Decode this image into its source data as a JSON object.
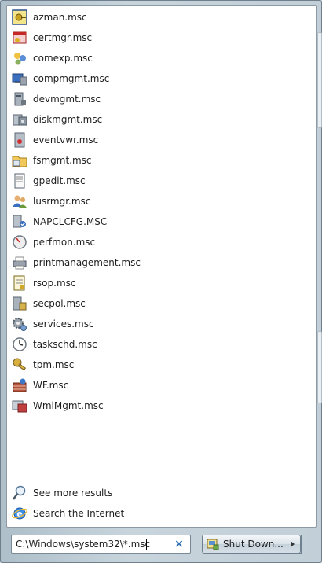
{
  "results": [
    {
      "label": "azman.msc",
      "icon": "azman-icon"
    },
    {
      "label": "certmgr.msc",
      "icon": "certmgr-icon"
    },
    {
      "label": "comexp.msc",
      "icon": "comexp-icon"
    },
    {
      "label": "compmgmt.msc",
      "icon": "compmgmt-icon"
    },
    {
      "label": "devmgmt.msc",
      "icon": "devmgmt-icon"
    },
    {
      "label": "diskmgmt.msc",
      "icon": "diskmgmt-icon"
    },
    {
      "label": "eventvwr.msc",
      "icon": "eventvwr-icon"
    },
    {
      "label": "fsmgmt.msc",
      "icon": "fsmgmt-icon"
    },
    {
      "label": "gpedit.msc",
      "icon": "gpedit-icon"
    },
    {
      "label": "lusrmgr.msc",
      "icon": "lusrmgr-icon"
    },
    {
      "label": "NAPCLCFG.MSC",
      "icon": "napclcfg-icon"
    },
    {
      "label": "perfmon.msc",
      "icon": "perfmon-icon"
    },
    {
      "label": "printmanagement.msc",
      "icon": "printmanagement-icon"
    },
    {
      "label": "rsop.msc",
      "icon": "rsop-icon"
    },
    {
      "label": "secpol.msc",
      "icon": "secpol-icon"
    },
    {
      "label": "services.msc",
      "icon": "services-icon"
    },
    {
      "label": "taskschd.msc",
      "icon": "taskschd-icon"
    },
    {
      "label": "tpm.msc",
      "icon": "tpm-icon"
    },
    {
      "label": "WF.msc",
      "icon": "wf-icon"
    },
    {
      "label": "WmiMgmt.msc",
      "icon": "wmimgmt-icon"
    }
  ],
  "links": {
    "see_more": "See more results",
    "search_internet": "Search the Internet"
  },
  "search": {
    "value": "C:\\Windows\\system32\\*.msc",
    "clear_glyph": "×"
  },
  "shutdown": {
    "label": "Shut Down..."
  }
}
